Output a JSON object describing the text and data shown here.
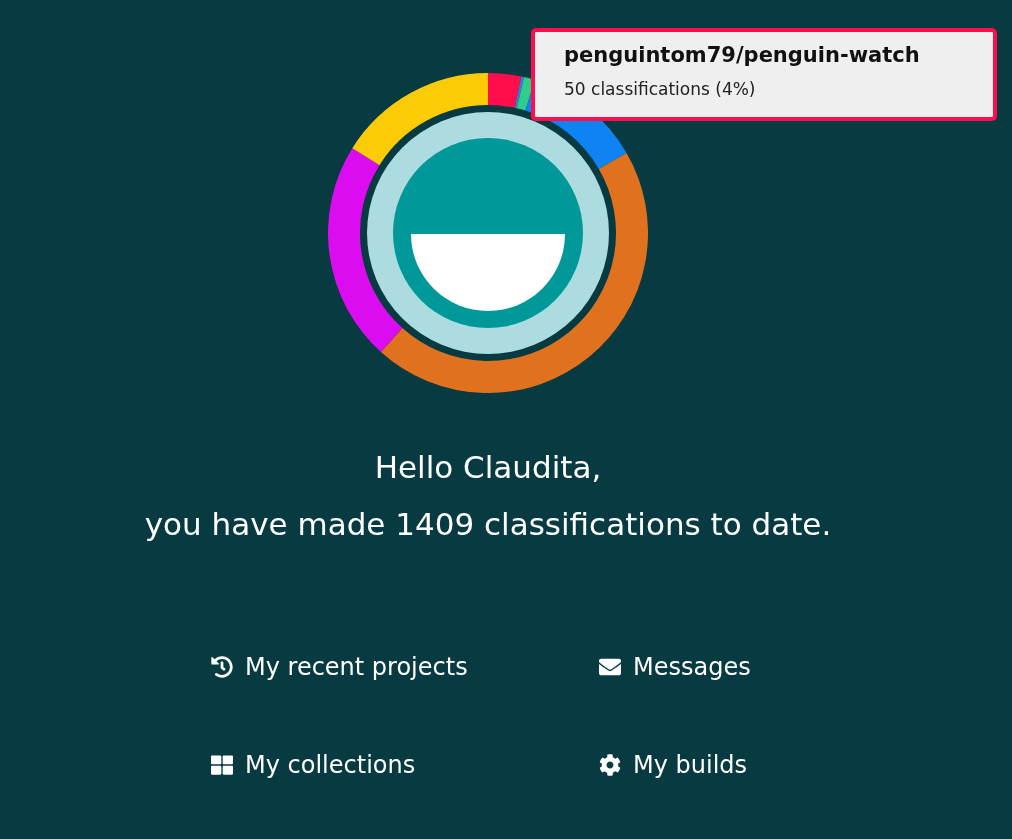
{
  "tooltip": {
    "title": "penguintom79/penguin-watch",
    "detail": "50 classifications (4%)"
  },
  "greeting": [
    "Hello Claudita,",
    "you have made 1409 classifications to date."
  ],
  "links": [
    {
      "label": "My recent projects",
      "kind": "history"
    },
    {
      "label": "Messages",
      "kind": "mail"
    },
    {
      "label": "My collections",
      "kind": "grid"
    },
    {
      "label": "My builds",
      "kind": "gear"
    }
  ]
}
